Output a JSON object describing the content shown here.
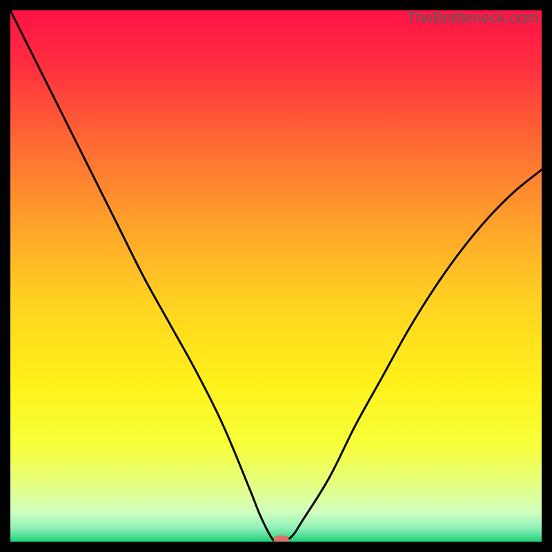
{
  "watermark": "TheBottleneck.com",
  "chart_data": {
    "type": "line",
    "title": "",
    "xlabel": "",
    "ylabel": "",
    "xlim": [
      0,
      100
    ],
    "ylim": [
      0,
      100
    ],
    "x": [
      0,
      5,
      10,
      15,
      20,
      25,
      30,
      35,
      40,
      45,
      47,
      49,
      50,
      51,
      53,
      55,
      60,
      65,
      70,
      75,
      80,
      85,
      90,
      95,
      100
    ],
    "values": [
      100,
      90,
      80,
      70,
      60,
      50,
      41,
      32,
      22,
      10,
      5,
      1,
      0,
      0,
      1,
      4,
      12,
      22,
      31,
      40,
      48,
      55,
      61,
      66,
      70
    ],
    "marker": {
      "x": 51,
      "y": 0
    },
    "gradient_stops": [
      {
        "offset": 0.0,
        "color": "#ff1347"
      },
      {
        "offset": 0.1,
        "color": "#ff2d3f"
      },
      {
        "offset": 0.25,
        "color": "#ff6a33"
      },
      {
        "offset": 0.4,
        "color": "#ffa12b"
      },
      {
        "offset": 0.55,
        "color": "#ffd321"
      },
      {
        "offset": 0.7,
        "color": "#fff11a"
      },
      {
        "offset": 0.82,
        "color": "#f6ff3a"
      },
      {
        "offset": 0.9,
        "color": "#e3ff8a"
      },
      {
        "offset": 0.945,
        "color": "#d0ffc0"
      },
      {
        "offset": 0.975,
        "color": "#8cf0b6"
      },
      {
        "offset": 1.0,
        "color": "#1fd07a"
      }
    ]
  }
}
